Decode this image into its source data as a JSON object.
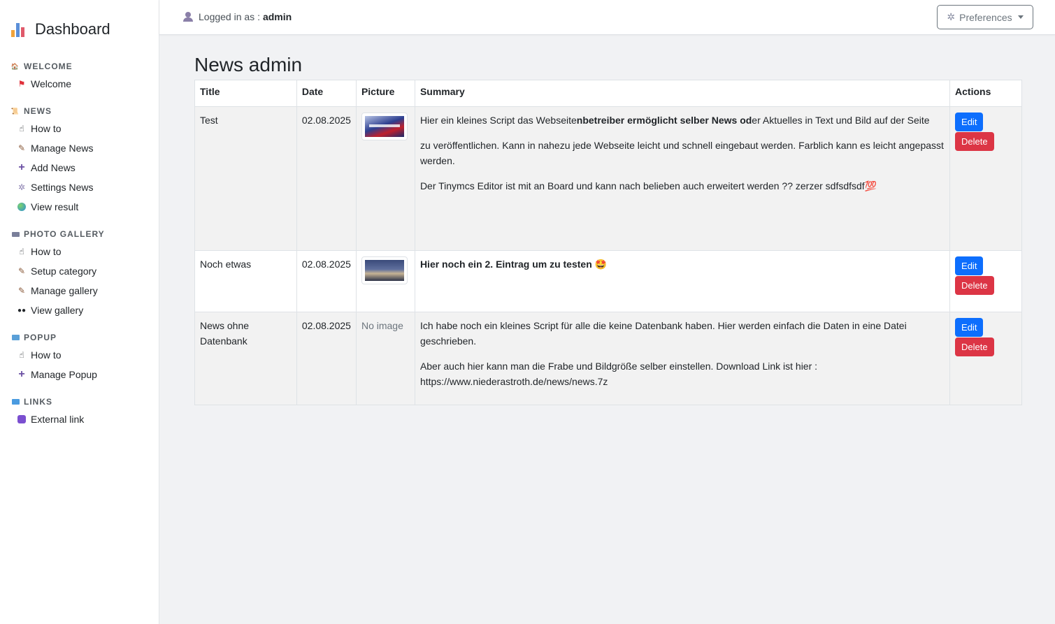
{
  "sidebar": {
    "brand": "Dashboard",
    "sections": [
      {
        "label": "WELCOME",
        "items": [
          {
            "label": "Welcome"
          }
        ]
      },
      {
        "label": "NEWS",
        "items": [
          {
            "label": "How to"
          },
          {
            "label": "Manage News"
          },
          {
            "label": "Add News"
          },
          {
            "label": "Settings News"
          },
          {
            "label": "View result"
          }
        ]
      },
      {
        "label": "PHOTO GALLERY",
        "items": [
          {
            "label": "How to"
          },
          {
            "label": "Setup category"
          },
          {
            "label": "Manage gallery"
          },
          {
            "label": "View gallery"
          }
        ]
      },
      {
        "label": "POPUP",
        "items": [
          {
            "label": "How to"
          },
          {
            "label": "Manage Popup"
          }
        ]
      },
      {
        "label": "LINKS",
        "items": [
          {
            "label": "External link"
          }
        ]
      }
    ]
  },
  "topbar": {
    "login_prefix": "Logged in as :",
    "username": "admin",
    "prefs_label": "Preferences"
  },
  "main": {
    "title": "News admin",
    "columns": [
      "Title",
      "Date",
      "Picture",
      "Summary",
      "Actions"
    ],
    "rows": [
      {
        "title": "Test",
        "date": "02.08.2025",
        "p1_pre": "Hier ein kleines Script das Webseite",
        "p1_bold": "nbetreiber ermöglicht selber News od",
        "p1_post": "er Aktuelles in Text und Bild auf der Seite",
        "p2": "zu veröffentlichen. Kann in nahezu jede Webseite leicht und schnell eingebaut werden. Farblich kann es leicht angepasst werden.",
        "p3": "Der Tinymcs Editor ist mit an Board und kann nach belieben auch erweitert werden ?? zerzer sdfsdfsdf💯"
      },
      {
        "title": "Noch etwas",
        "date": "02.08.2025",
        "p1_bold": "Hier noch ein 2. Eintrag um zu testen 🤩"
      },
      {
        "title": "News ohne Datenbank",
        "date": "02.08.2025",
        "picture_text": "No image",
        "p1": "Ich habe noch ein kleines Script für alle die keine Datenbank haben. Hier werden einfach die Daten in eine Datei geschrieben.",
        "p2": "Aber auch hier kann man die Frabe und Bildgröße selber einstellen. Download Link ist hier : https://www.niederastroth.de/news/news.7z"
      }
    ],
    "edit_label": "Edit",
    "delete_label": "Delete"
  },
  "colors": {
    "edit": "#0d6efd",
    "delete": "#dc3545",
    "background": "#f1f2f4"
  },
  "icons": [
    "chart-icon",
    "house-icon",
    "flag-icon",
    "scroll-icon",
    "hand-icon",
    "brush-icon",
    "plus-icon",
    "gear-icon",
    "globe-icon",
    "frame-icon",
    "eyes-icon",
    "popup-icon",
    "arrow-icon",
    "viber-icon",
    "user-icon"
  ]
}
